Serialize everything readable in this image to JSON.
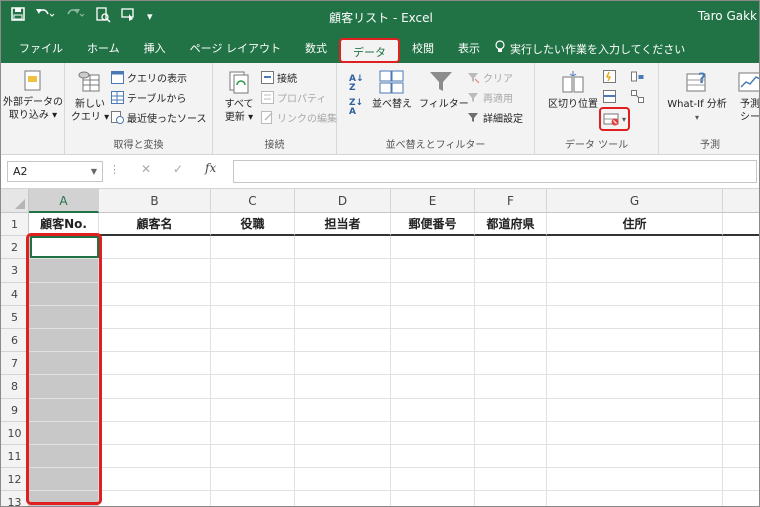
{
  "window": {
    "title": "顧客リスト - Excel",
    "user": "Taro Gakk",
    "qat": {
      "save_icon": "save-icon",
      "undo_icon": "undo-icon",
      "redo_icon": "redo-icon",
      "customize": "▾"
    }
  },
  "tabs": [
    {
      "label": "ファイル"
    },
    {
      "label": "ホーム"
    },
    {
      "label": "挿入"
    },
    {
      "label": "ページ レイアウト"
    },
    {
      "label": "数式"
    },
    {
      "label": "データ",
      "active": true
    },
    {
      "label": "校閲"
    },
    {
      "label": "表示"
    }
  ],
  "tell_me": "実行したい作業を入力してください",
  "ribbon": {
    "external": {
      "label": "外部データの\n取り込み ▾"
    },
    "get_transform": {
      "new_query": "新しい\nクエリ ▾",
      "show_queries": "クエリの表示",
      "from_table": "テーブルから",
      "recent_sources": "最近使ったソース",
      "group_label": "取得と変換"
    },
    "connections": {
      "refresh_all": "すべて\n更新 ▾",
      "connections": "接続",
      "properties": "プロパティ",
      "edit_links": "リンクの編集",
      "group_label": "接続"
    },
    "sort_filter": {
      "sort": "並べ替え",
      "filter": "フィルター",
      "clear": "クリア",
      "reapply": "再適用",
      "advanced": "詳細設定",
      "group_label": "並べ替えとフィルター"
    },
    "data_tools": {
      "text_to_columns": "区切り位置",
      "group_label": "データ ツール"
    },
    "forecast": {
      "what_if": "What-If 分析",
      "forecast_sheet": "予測\nシー",
      "group_label": "予測"
    }
  },
  "formula_bar": {
    "name_box": "A2",
    "cancel": "✕",
    "enter": "✓",
    "fx": "fx",
    "value": ""
  },
  "sheet": {
    "columns": [
      "A",
      "B",
      "C",
      "D",
      "E",
      "F",
      "G"
    ],
    "rows": [
      "1",
      "2",
      "3",
      "4",
      "5",
      "6",
      "7",
      "8",
      "9",
      "10",
      "11",
      "12",
      "13"
    ],
    "headers": [
      "顧客No.",
      "顧客名",
      "役職",
      "担当者",
      "郵便番号",
      "都道府県",
      "住所"
    ],
    "selected_column": "A",
    "active_cell": "A2",
    "highlight_color": "#e02020",
    "accent_color": "#217346"
  }
}
